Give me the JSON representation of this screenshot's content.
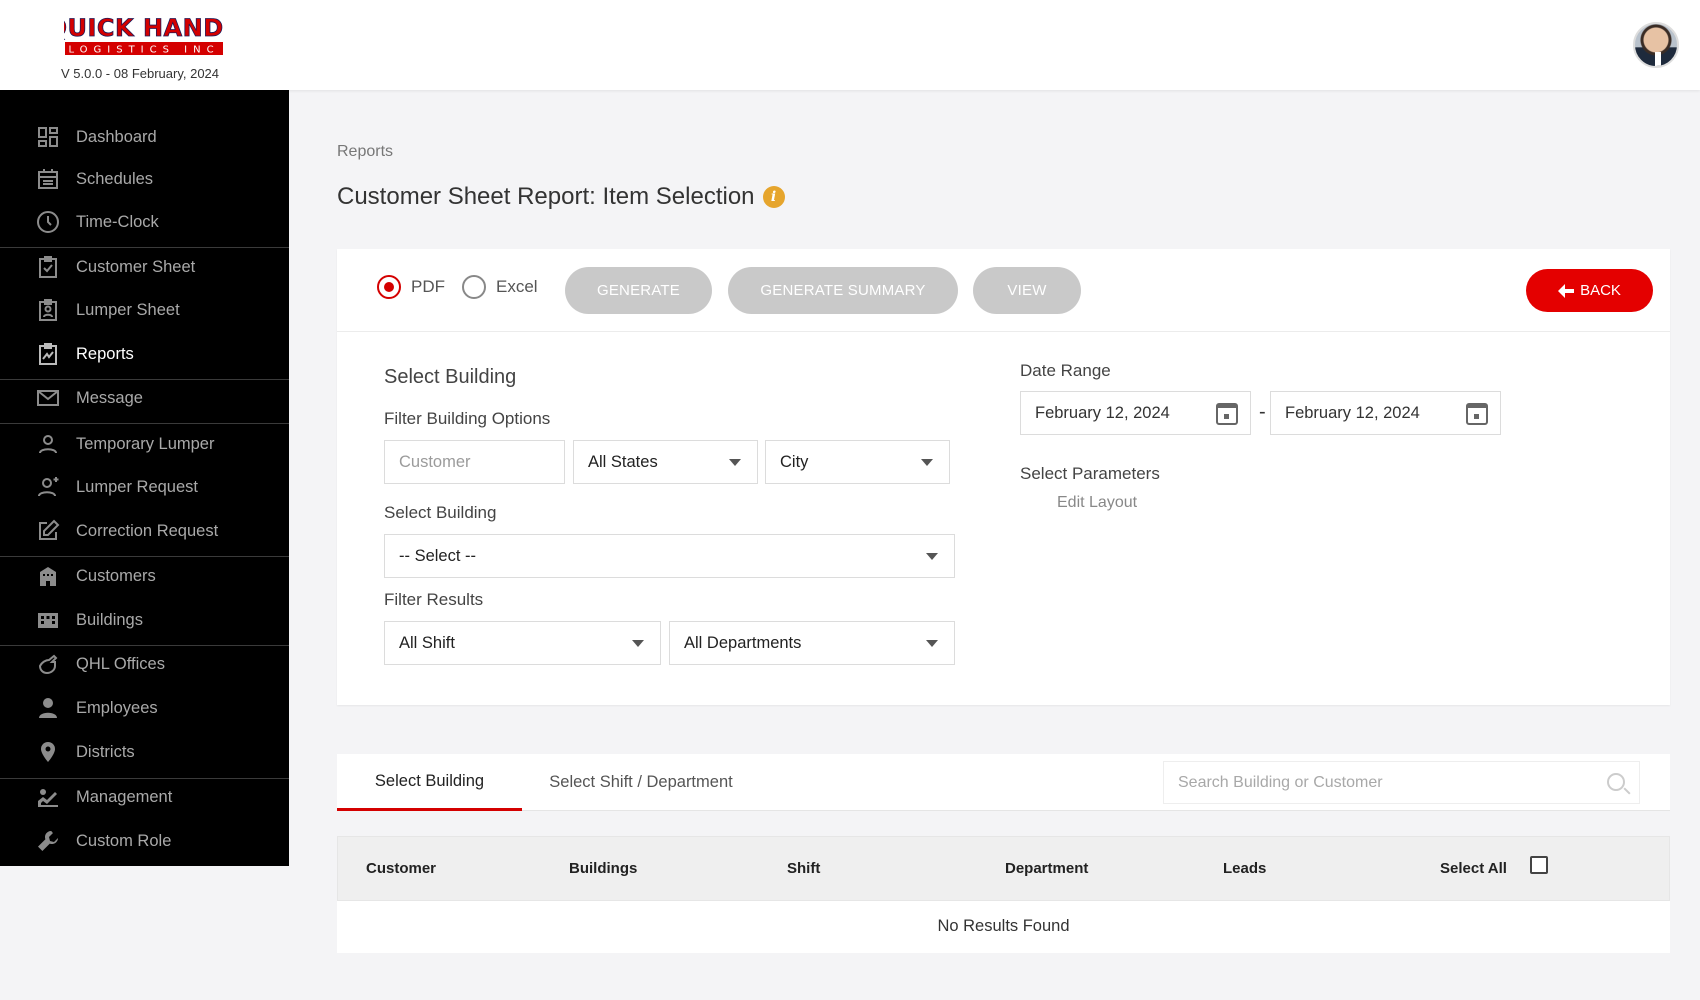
{
  "brand": {
    "logo_line1": "QUICK HANDS",
    "logo_line2": "LOGISTICS INC",
    "version": "V 5.0.0 - 08 February, 2024"
  },
  "sidebar": {
    "items": [
      {
        "label": "Dashboard",
        "icon": "dashboard-icon"
      },
      {
        "label": "Schedules",
        "icon": "calendar-icon"
      },
      {
        "label": "Time-Clock",
        "icon": "clock-icon"
      },
      {
        "label": "Customer Sheet",
        "icon": "clipboard-check-icon"
      },
      {
        "label": "Lumper Sheet",
        "icon": "clipboard-person-icon"
      },
      {
        "label": "Reports",
        "icon": "clipboard-chart-icon"
      },
      {
        "label": "Message",
        "icon": "envelope-icon"
      },
      {
        "label": "Temporary Lumper",
        "icon": "user-outline-icon"
      },
      {
        "label": "Lumper Request",
        "icon": "user-plus-icon"
      },
      {
        "label": "Correction Request",
        "icon": "edit-icon"
      },
      {
        "label": "Customers",
        "icon": "building-icon"
      },
      {
        "label": "Buildings",
        "icon": "warehouse-icon"
      },
      {
        "label": "QHL Offices",
        "icon": "hand-icon"
      },
      {
        "label": "Employees",
        "icon": "person-icon"
      },
      {
        "label": "Districts",
        "icon": "map-pin-icon"
      },
      {
        "label": "Management",
        "icon": "chart-person-icon"
      },
      {
        "label": "Custom Role",
        "icon": "wrench-icon"
      }
    ],
    "active": "Reports"
  },
  "header": {
    "breadcrumb": "Reports",
    "title": "Customer Sheet Report: Item Selection"
  },
  "toolbar": {
    "format_pdf": "PDF",
    "format_excel": "Excel",
    "selected_format": "PDF",
    "generate": "GENERATE",
    "generate_summary": "GENERATE SUMMARY",
    "view": "VIEW",
    "back": "BACK"
  },
  "form": {
    "select_building_heading": "Select Building",
    "filter_building_options": "Filter Building Options",
    "customer_placeholder": "Customer",
    "states_value": "All States",
    "city_value": "City",
    "select_building_label": "Select Building",
    "building_value": "-- Select --",
    "filter_results": "Filter Results",
    "shift_value": "All Shift",
    "departments_value": "All Departments",
    "date_range_label": "Date Range",
    "date_from": "February 12, 2024",
    "date_to": "February 12, 2024",
    "date_separator": "-",
    "select_parameters": "Select Parameters",
    "edit_layout": "Edit Layout"
  },
  "tabs": {
    "items": [
      "Select Building",
      "Select Shift / Department"
    ],
    "active": "Select Building",
    "search_placeholder": "Search Building or Customer"
  },
  "table": {
    "columns": [
      "Customer",
      "Buildings",
      "Shift",
      "Department",
      "Leads",
      "Select All"
    ],
    "empty": "No Results Found"
  },
  "colors": {
    "accent": "#e40000",
    "sidebar_bg": "#000000",
    "info": "#e6a52d",
    "disabled_button": "#c9c9c9"
  }
}
